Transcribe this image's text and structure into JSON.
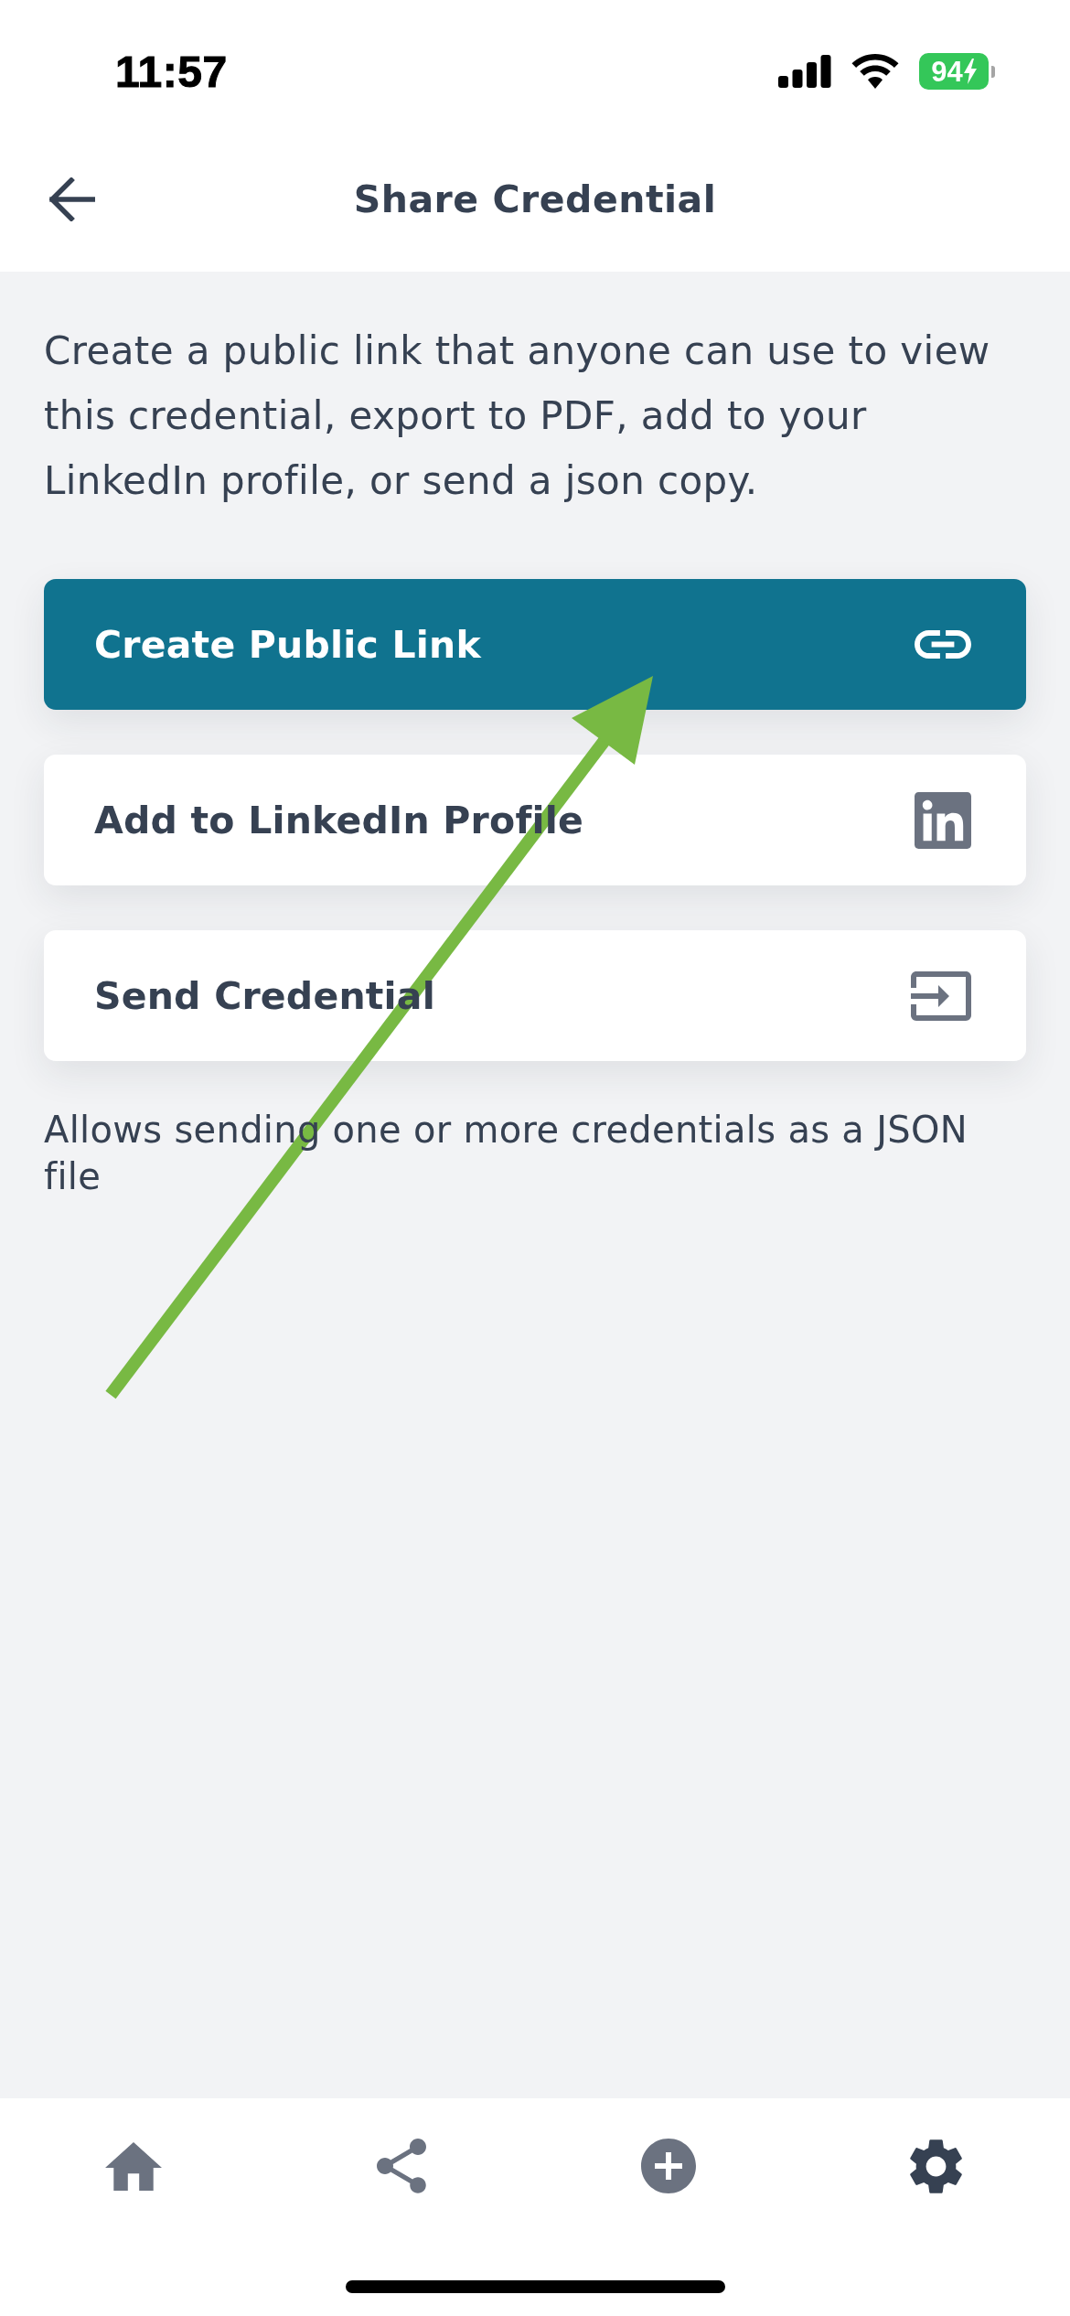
{
  "status_bar": {
    "time": "11:57",
    "battery": "94"
  },
  "header": {
    "title": "Share Credential"
  },
  "description": "Create a public link that anyone can use to view this credential, export to PDF, add to your LinkedIn profile, or send a json copy.",
  "actions": [
    {
      "label": "Create Public Link",
      "kind": "link",
      "filled": true
    },
    {
      "label": "Add to LinkedIn Profile",
      "kind": "linkedin",
      "filled": false
    },
    {
      "label": "Send Credential",
      "kind": "send",
      "filled": false
    }
  ],
  "note": "Allows sending one or more credentials as a JSON file",
  "tab_bar": [
    {
      "kind": "home",
      "selected": false
    },
    {
      "kind": "share",
      "selected": false
    },
    {
      "kind": "add",
      "selected": false
    },
    {
      "kind": "settings",
      "selected": true
    }
  ]
}
